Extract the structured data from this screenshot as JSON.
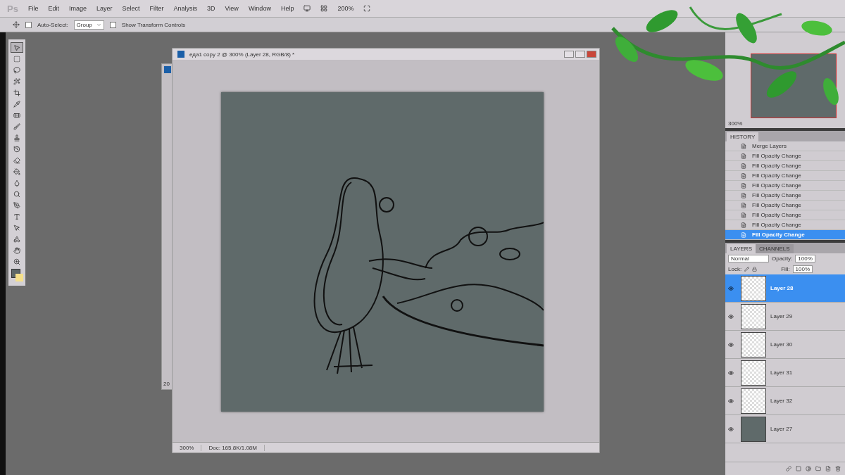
{
  "menu_bar": {
    "app_icon": "Ps",
    "items": [
      "File",
      "Edit",
      "Image",
      "Layer",
      "Select",
      "Filter",
      "Analysis",
      "3D",
      "View",
      "Window",
      "Help"
    ],
    "zoom": "200%"
  },
  "options_bar": {
    "auto_select": {
      "label": "Auto-Select:",
      "checked": false
    },
    "auto_select_target": "Group",
    "show_transform": {
      "label": "Show Transform Controls",
      "checked": false
    }
  },
  "tools": [
    {
      "selected": true
    },
    {
      "selected": false
    },
    {
      "selected": false
    },
    {
      "selected": false
    },
    {
      "selected": false
    },
    {
      "selected": false
    },
    {
      "selected": false
    },
    {
      "selected": false
    },
    {
      "selected": false
    },
    {
      "selected": false
    },
    {
      "selected": false
    },
    {
      "selected": false
    },
    {
      "selected": false
    },
    {
      "selected": false
    },
    {
      "selected": false
    },
    {
      "selected": false
    },
    {
      "selected": false
    },
    {
      "selected": false
    },
    {
      "selected": false
    },
    {
      "selected": false
    }
  ],
  "background_window": {
    "label": "20"
  },
  "document": {
    "title": "еда1 copy 2 @ 300% (Layer 28, RGB/8) *",
    "zoom": "300%",
    "doc_info": "Doc: 165.8K/1.08M"
  },
  "navigator": {
    "zoom": "300%"
  },
  "history": {
    "tab": "HISTORY",
    "items": [
      {
        "label": "Merge Layers",
        "selected": false
      },
      {
        "label": "Fill Opacity Change",
        "selected": false
      },
      {
        "label": "Fill Opacity Change",
        "selected": false
      },
      {
        "label": "Fill Opacity Change",
        "selected": false
      },
      {
        "label": "Fill Opacity Change",
        "selected": false
      },
      {
        "label": "Fill Opacity Change",
        "selected": false
      },
      {
        "label": "Fill Opacity Change",
        "selected": false
      },
      {
        "label": "Fill Opacity Change",
        "selected": false
      },
      {
        "label": "Fill Opacity Change",
        "selected": false
      },
      {
        "label": "Fill Opacity Change",
        "selected": true
      }
    ]
  },
  "layers": {
    "tabs": [
      {
        "label": "LAYERS",
        "selected": true
      },
      {
        "label": "CHANNELS",
        "selected": false
      }
    ],
    "blend_mode": "Normal",
    "opacity_label": "Opacity:",
    "opacity": "100%",
    "lock_label": "Lock:",
    "fill_label": "Fill:",
    "fill": "100%",
    "items": [
      {
        "name": "Layer 28",
        "selected": true,
        "visible": true,
        "kind": "transparent"
      },
      {
        "name": "Layer 29",
        "selected": false,
        "visible": true,
        "kind": "transparent"
      },
      {
        "name": "Layer 30",
        "selected": false,
        "visible": true,
        "kind": "transparent"
      },
      {
        "name": "Layer 31",
        "selected": false,
        "visible": true,
        "kind": "transparent"
      },
      {
        "name": "Layer 32",
        "selected": false,
        "visible": true,
        "kind": "transparent"
      },
      {
        "name": "Layer 27",
        "selected": false,
        "visible": true,
        "kind": "filled"
      }
    ]
  }
}
